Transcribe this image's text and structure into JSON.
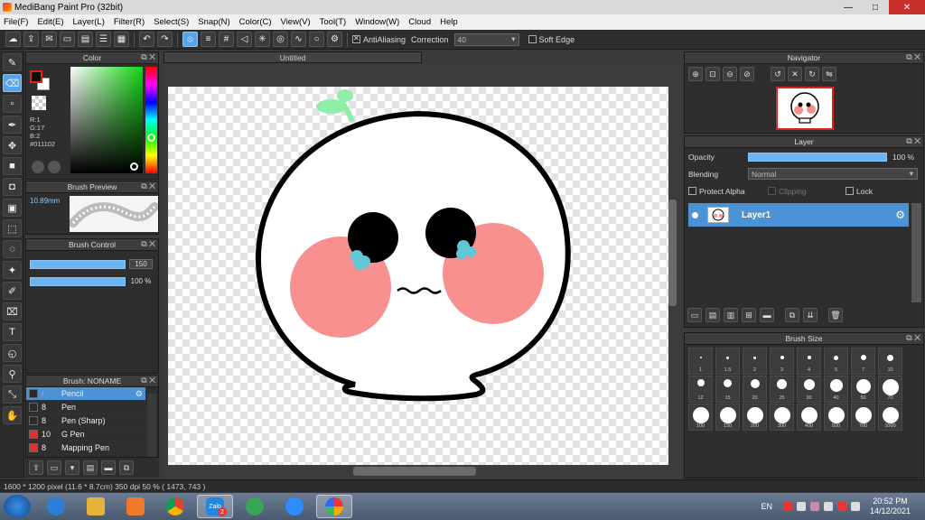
{
  "window": {
    "title": "MediBang Paint Pro (32bit)",
    "min": "—",
    "max": "□",
    "close": "✕"
  },
  "menu": [
    "File(F)",
    "Edit(E)",
    "Layer(L)",
    "Filter(R)",
    "Select(S)",
    "Snap(N)",
    "Color(C)",
    "View(V)",
    "Tool(T)",
    "Window(W)",
    "Cloud",
    "Help"
  ],
  "toolbar": {
    "antialias_label": "AntiAliasing",
    "correction_label": "Correction",
    "correction_value": "40",
    "soft_edge_label": "Soft Edge"
  },
  "color_panel": {
    "title": "Color",
    "r": "R:1",
    "g": "G:17",
    "b": "B:2",
    "hex": "#011102"
  },
  "brush_preview": {
    "title": "Brush Preview",
    "size": "10.89mm"
  },
  "brush_control": {
    "title": "Brush Control",
    "size": "150",
    "opacity": "100 %"
  },
  "brush_list": {
    "title": "Brush: NONAME",
    "items": [
      {
        "num": "/",
        "name": "Pencil",
        "color": "#2b2b2b",
        "selected": true
      },
      {
        "num": "8",
        "name": "Pen",
        "color": "#2b2b2b",
        "selected": false
      },
      {
        "num": "8",
        "name": "Pen (Sharp)",
        "color": "#2b2b2b",
        "selected": false
      },
      {
        "num": "10",
        "name": "G Pen",
        "color": "#e03030",
        "selected": false
      },
      {
        "num": "8",
        "name": "Mapping Pen",
        "color": "#e03030",
        "selected": false
      }
    ]
  },
  "canvas": {
    "tab": "Untitled"
  },
  "navigator": {
    "title": "Navigator"
  },
  "layer_panel": {
    "title": "Layer",
    "opacity_label": "Opacity",
    "opacity_value": "100 %",
    "blending_label": "Blending",
    "blending_value": "Normal",
    "protect_alpha": "Protect Alpha",
    "clipping": "Clipping",
    "lock": "Lock",
    "layer_name": "Layer1"
  },
  "brush_size": {
    "title": "Brush Size",
    "sizes": [
      "1",
      "1.5",
      "2",
      "3",
      "4",
      "5",
      "7",
      "10",
      "12",
      "15",
      "20",
      "25",
      "30",
      "40",
      "50",
      "70",
      "100",
      "150",
      "200",
      "300",
      "400",
      "500",
      "700",
      "1000"
    ]
  },
  "status": {
    "text": "1600 * 1200 pixel  (11.6 * 8.7cm)  350 dpi  50 %  ( 1473, 743 )"
  },
  "taskbar": {
    "lang": "EN",
    "time": "20:52 PM",
    "date": "14/12/2021",
    "zalo_label": "Zalo",
    "zalo_badge": "2"
  },
  "colors": {
    "accent": "#5aa4e6",
    "panel": "#2e2e2e",
    "blush": "#f7908f",
    "leaf": "#8ef0a8",
    "tear": "#5fc7d6"
  }
}
